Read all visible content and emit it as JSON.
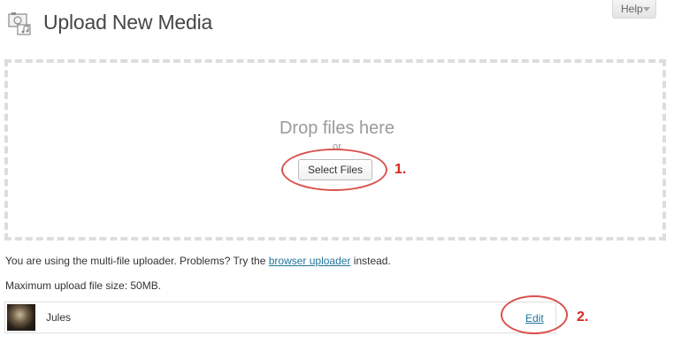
{
  "header": {
    "title": "Upload New Media",
    "help_label": "Help"
  },
  "uploader": {
    "drop_text": "Drop files here",
    "or_text": "or",
    "select_button_label": "Select Files"
  },
  "notes": {
    "multi_prefix": "You are using the multi-file uploader. Problems? Try the ",
    "browser_link": "browser uploader",
    "multi_suffix": " instead.",
    "max_size": "Maximum upload file size: 50MB."
  },
  "media_items": [
    {
      "title": "Jules",
      "edit_label": "Edit"
    }
  ],
  "annotations": {
    "step1": "1.",
    "step2": "2.",
    "color": "#d8281f"
  }
}
